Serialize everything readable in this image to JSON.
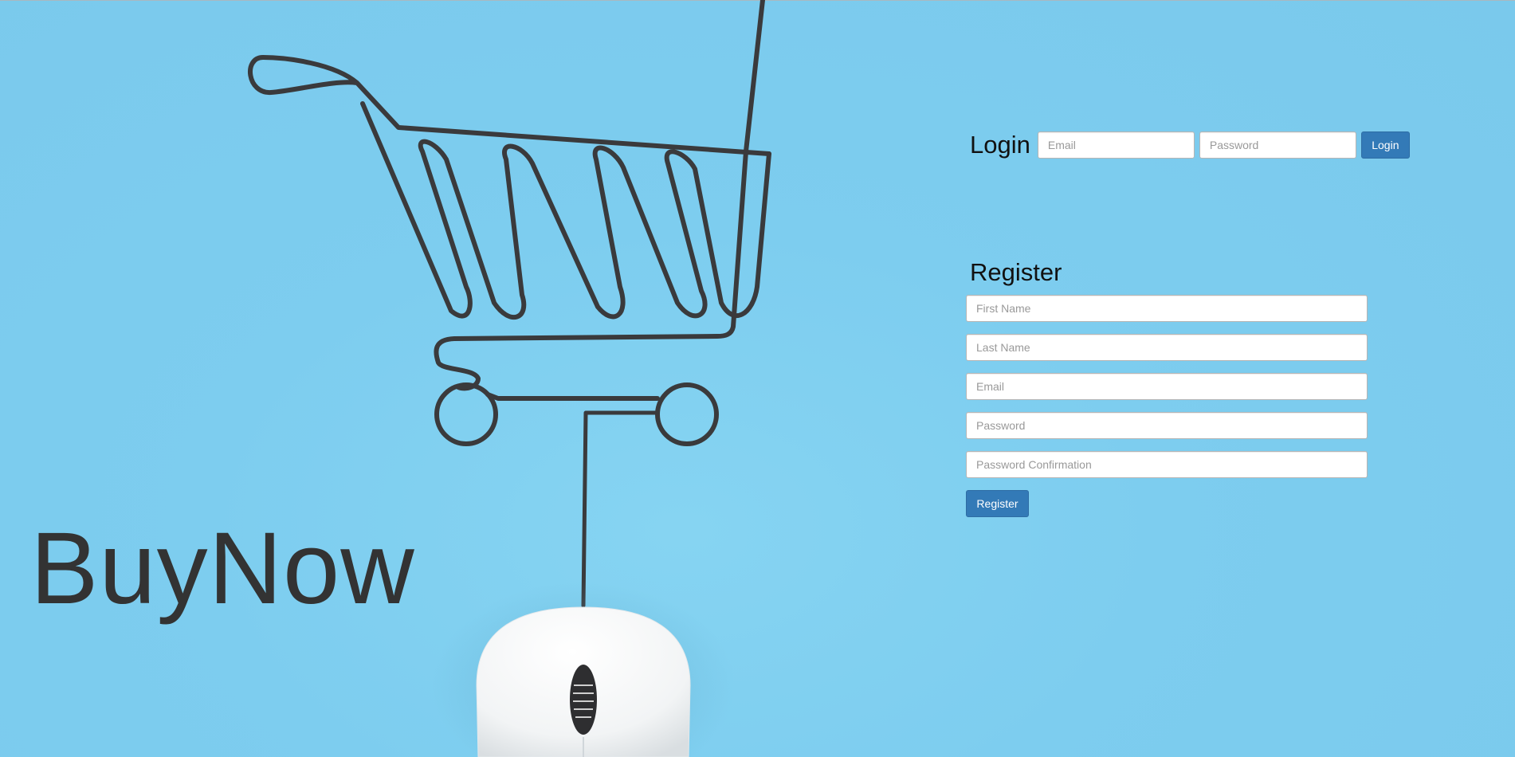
{
  "brand": {
    "name": "BuyNow"
  },
  "login": {
    "title": "Login",
    "email_placeholder": "Email",
    "password_placeholder": "Password",
    "button_label": "Login"
  },
  "register": {
    "title": "Register",
    "first_name_placeholder": "First Name",
    "last_name_placeholder": "Last Name",
    "email_placeholder": "Email",
    "password_placeholder": "Password",
    "password_confirmation_placeholder": "Password Confirmation",
    "button_label": "Register"
  },
  "colors": {
    "background": "#7dcdef",
    "primary_button": "#337ab7",
    "brand_text": "#333333",
    "wire": "#3a3a3c"
  },
  "background_image": {
    "icons": [
      "shopping-cart-wire-icon",
      "computer-mouse-icon"
    ]
  }
}
